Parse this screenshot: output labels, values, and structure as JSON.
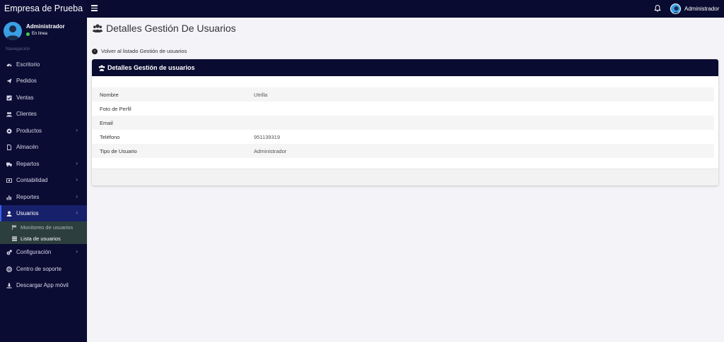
{
  "app": {
    "brand": "Empresa de Prueba"
  },
  "topbar": {
    "user_name": "Administrador"
  },
  "sidebar": {
    "profile": {
      "name": "Administrador",
      "status": "En línea"
    },
    "nav_header": "Navegación",
    "items": [
      {
        "label": "Escritorio"
      },
      {
        "label": "Pedidos"
      },
      {
        "label": "Ventas"
      },
      {
        "label": "Clientes"
      },
      {
        "label": "Productos"
      },
      {
        "label": "Almacén"
      },
      {
        "label": "Repartos"
      },
      {
        "label": "Contabilidad"
      },
      {
        "label": "Reportes"
      },
      {
        "label": "Usuarios"
      },
      {
        "label": "Configuración"
      },
      {
        "label": "Centro de soporte"
      },
      {
        "label": "Descargar App móvil"
      }
    ],
    "submenu": [
      {
        "label": "Monitoreo de usuarios"
      },
      {
        "label": "Lista de usuarios"
      }
    ]
  },
  "main": {
    "page_title": "Detalles Gestión De Usuarios",
    "back_link": "Volver al listado Gestión de usuarios",
    "card_title": "Detalles Gestión de usuarios",
    "rows": [
      {
        "label": "Nombre",
        "value": "Utrilla"
      },
      {
        "label": "Foto de Perfil",
        "value": ""
      },
      {
        "label": "Email",
        "value": ""
      },
      {
        "label": "Teléfono",
        "value": "951139319"
      },
      {
        "label": "Tipo de Usuario",
        "value": "Administrador"
      }
    ]
  },
  "colors": {
    "topbar": "#090b30",
    "sidebar": "#0a0c33",
    "active": "#17206a",
    "submenu": "#2c3f3e",
    "online": "#3ecf4f",
    "avatar": "#3aa0e6"
  }
}
